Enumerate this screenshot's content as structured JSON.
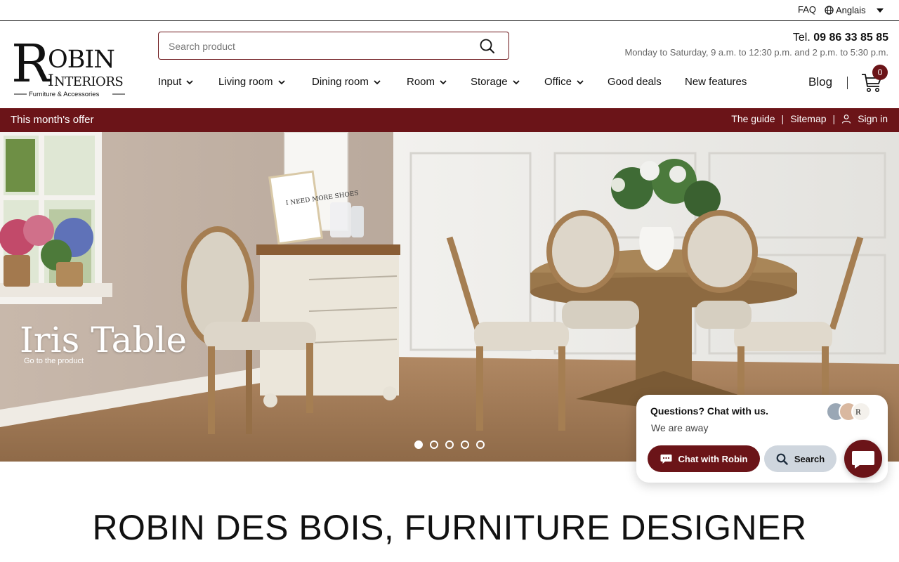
{
  "topbar": {
    "faq": "FAQ",
    "language": "Anglais"
  },
  "header": {
    "logo": {
      "line1": "OBIN",
      "initial": "R",
      "line2": "NTERIORS",
      "initial2": "I",
      "tagline": "Furniture & Accessories"
    },
    "search_placeholder": "Search product",
    "tel_label": "Tel.",
    "tel_number": "09 86 33 85 85",
    "hours": "Monday to Saturday, 9 a.m. to 12:30 p.m. and 2 p.m. to 5:30 p.m."
  },
  "nav": {
    "items": [
      {
        "label": "Input",
        "has_dropdown": true
      },
      {
        "label": "Living room",
        "has_dropdown": true
      },
      {
        "label": "Dining room",
        "has_dropdown": true
      },
      {
        "label": "Room",
        "has_dropdown": true
      },
      {
        "label": "Storage",
        "has_dropdown": true
      },
      {
        "label": "Office",
        "has_dropdown": true
      },
      {
        "label": "Good deals",
        "has_dropdown": false
      },
      {
        "label": "New features",
        "has_dropdown": false
      }
    ],
    "blog": "Blog",
    "cart_count": "0"
  },
  "offerbar": {
    "offer": "This month's offer",
    "guide": "The guide",
    "sitemap": "Sitemap",
    "signin": "Sign in"
  },
  "hero": {
    "title": "Iris Table",
    "link": "Go to the product",
    "slides_total": 5,
    "active_slide": 1,
    "frame_text": "I NEED MORE SHOES"
  },
  "chat": {
    "question": "Questions? Chat with us.",
    "status": "We are away",
    "chat_button": "Chat with Robin",
    "search_button": "Search"
  },
  "main": {
    "headline": "ROBIN DES BOIS, FURNITURE DESIGNER"
  },
  "colors": {
    "brand": "#6b1418",
    "secondary_button": "#cfd6de"
  },
  "icons": [
    "globe-icon",
    "caret-down-icon",
    "search-icon",
    "chevron-down-icon",
    "cart-icon",
    "user-icon",
    "chat-bubble-icon"
  ]
}
